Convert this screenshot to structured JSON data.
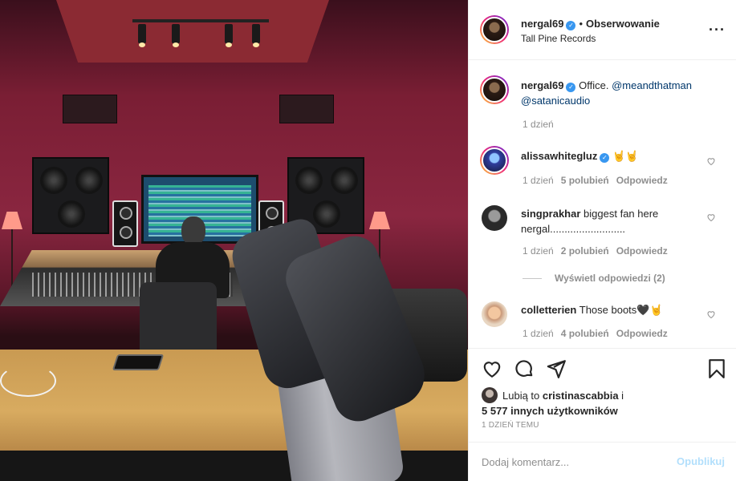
{
  "post": {
    "username": "nergal69",
    "verified_icon": "verified-badge-icon",
    "separator": "•",
    "follow_label": "Obserwowanie",
    "location": "Tall Pine Records",
    "more_icon": "more-options-icon"
  },
  "caption": {
    "username": "nergal69",
    "text": "Office.",
    "mentions": [
      "@meandthatman",
      "@satanicaudio"
    ],
    "time": "1 dzień"
  },
  "comments": [
    {
      "username": "alissawhitegluz",
      "verified": true,
      "text": "🤘🤘",
      "time": "1 dzień",
      "likes": "5 polubień",
      "reply_label": "Odpowiedz"
    },
    {
      "username": "singprakhar",
      "verified": false,
      "text": "biggest fan here nergal..........................",
      "time": "1 dzień",
      "likes": "2 polubień",
      "reply_label": "Odpowiedz"
    },
    {
      "username": "colletterien",
      "verified": false,
      "text": "Those boots🖤🤘",
      "time": "1 dzień",
      "likes": "4 polubień",
      "reply_label": "Odpowiedz"
    }
  ],
  "view_replies": "Wyświetl odpowiedzi (2)",
  "likes": {
    "prefix": "Lubią to",
    "user": "cristinascabbia",
    "conj": "i",
    "others": "5 577 innych użytkowników"
  },
  "time_ago": "1 DZIEŃ TEMU",
  "comment_box": {
    "placeholder": "Dodaj komentarz...",
    "publish_label": "Opublikuj"
  },
  "colors": {
    "link": "#00376b",
    "verified": "#3897f0",
    "publish_disabled": "#b2dffc",
    "muted": "#8e8e8e"
  }
}
